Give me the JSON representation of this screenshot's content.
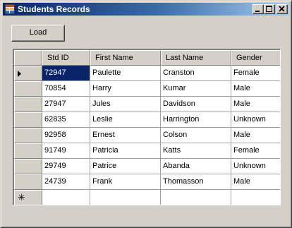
{
  "window": {
    "title": "Students Records"
  },
  "toolbar": {
    "load_label": "Load"
  },
  "grid": {
    "columns": [
      "Std ID",
      "First Name",
      "Last Name",
      "Gender"
    ],
    "rows": [
      [
        "72947",
        "Paulette",
        "Cranston",
        "Female"
      ],
      [
        "70854",
        "Harry",
        "Kumar",
        "Male"
      ],
      [
        "27947",
        "Jules",
        "Davidson",
        "Male"
      ],
      [
        "62835",
        "Leslie",
        "Harrington",
        "Unknown"
      ],
      [
        "92958",
        "Ernest",
        "Colson",
        "Male"
      ],
      [
        "91749",
        "Patricia",
        "Katts",
        "Female"
      ],
      [
        "29749",
        "Patrice",
        "Abanda",
        "Unknown"
      ],
      [
        "24739",
        "Frank",
        "Thomasson",
        "Male"
      ]
    ],
    "selected_row": 0,
    "new_row_marker": "✳"
  },
  "icons": {
    "app": "datagrid-app-icon",
    "minimize": "minimize-icon",
    "maximize": "maximize-icon",
    "close": "close-icon",
    "current_row": "row-pointer-icon"
  },
  "colors": {
    "titlebar": "#0a246a",
    "selection": "#0a246a",
    "face": "#d4d0c8"
  }
}
